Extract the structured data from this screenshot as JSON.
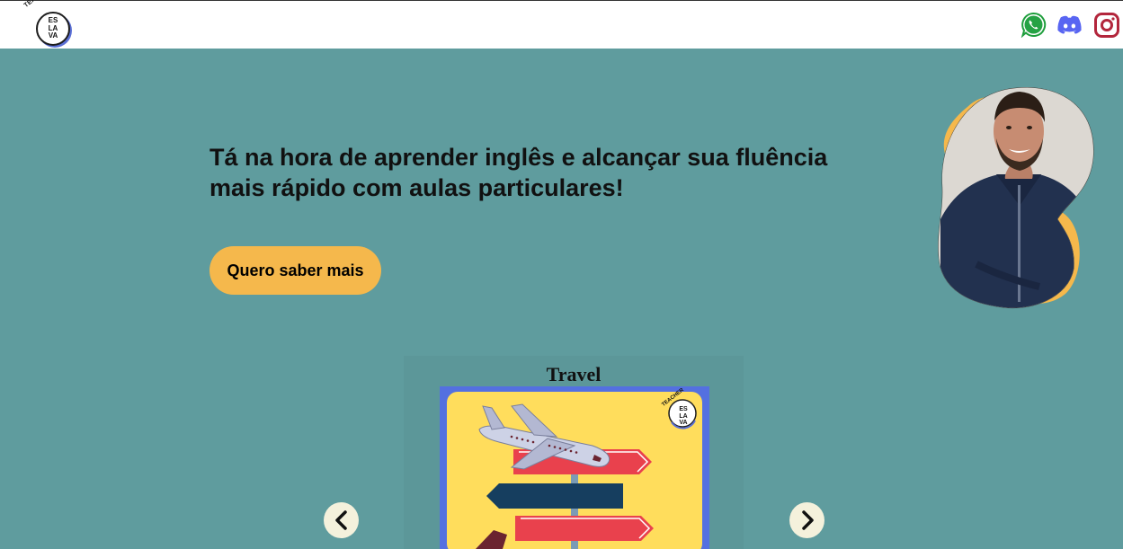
{
  "header": {
    "logo": {
      "arc_text": "TEACHER",
      "line1": "ES",
      "line2": "LA",
      "line3": "VA",
      "icon": "eslava-logo"
    },
    "social": [
      {
        "name": "whatsapp",
        "icon": "whatsapp-icon",
        "color": "#25a244"
      },
      {
        "name": "discord",
        "icon": "discord-icon",
        "color": "#5865f2"
      },
      {
        "name": "instagram",
        "icon": "instagram-icon",
        "color": "#c13584"
      }
    ]
  },
  "hero": {
    "headline_line1": "Tá na hora de aprender inglês e alcançar sua fluência",
    "headline_line2": "mais rápido com aulas particulares!",
    "cta_label": "Quero saber mais",
    "portrait": "teacher-portrait",
    "blob_color": "#f5b84c"
  },
  "carousel": {
    "title": "Travel",
    "image": "travel-signpost-illustration",
    "prev_icon": "chevron-left-icon",
    "next_icon": "chevron-right-icon",
    "image_logo": {
      "arc_text": "TEACHER",
      "line1": "ES",
      "line2": "LA",
      "line3": "VA"
    }
  },
  "colors": {
    "background": "#5f9c9e",
    "header_bg": "#ffffff",
    "accent": "#f5b84c",
    "card_frame": "#5470e0",
    "card_inner": "#ffdd5c"
  }
}
